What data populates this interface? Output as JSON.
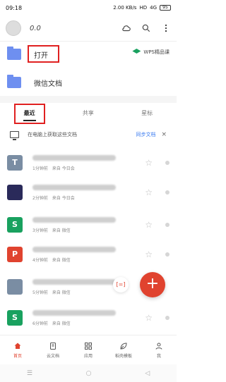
{
  "status": {
    "time": "09:18",
    "speed": "2.00 KB/s",
    "network": "HD",
    "signal": "4G",
    "battery": "95"
  },
  "header": {
    "username": "0.0"
  },
  "quick": {
    "items": [
      {
        "label": "打开"
      },
      {
        "label": "微信文档"
      }
    ],
    "promo": "WPS精品课"
  },
  "tabs": [
    {
      "label": "最近"
    },
    {
      "label": "共享"
    },
    {
      "label": "星标"
    }
  ],
  "hint": {
    "text": "在电脑上获取这些文档",
    "link": "同步文档",
    "close": "×"
  },
  "docs": [
    {
      "type": "T",
      "color": "#7a8da3",
      "meta": "1分钟前　来自 今日会"
    },
    {
      "type": "",
      "color": "#2a2a5a",
      "meta": "2分钟前　来自 今日会"
    },
    {
      "type": "S",
      "color": "#19a15f",
      "meta": "3分钟前　来自 微信"
    },
    {
      "type": "P",
      "color": "#e0432f",
      "meta": "4分钟前　来自 微信"
    },
    {
      "type": "",
      "color": "#7a8da3",
      "meta": "5分钟前　来自 微信"
    },
    {
      "type": "S",
      "color": "#19a15f",
      "meta": "6分钟前　来自 微信"
    }
  ],
  "fab": {
    "label": "+"
  },
  "scan": {
    "label": "[=]"
  },
  "bottom_nav": [
    {
      "label": "首页"
    },
    {
      "label": "云文档"
    },
    {
      "label": "应用"
    },
    {
      "label": "稻壳模板"
    },
    {
      "label": "我"
    }
  ],
  "accent": "#e0432f"
}
